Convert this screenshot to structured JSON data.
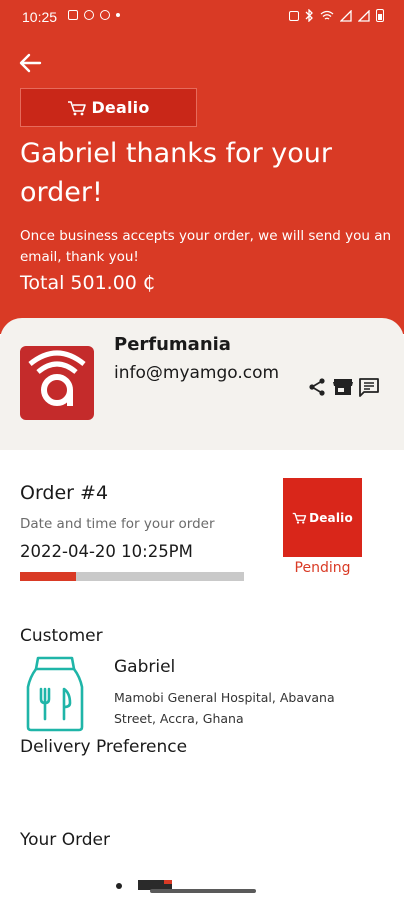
{
  "status_bar": {
    "time": "10:25",
    "left_icons": [
      "image-icon",
      "whatsapp-icon",
      "notification-icon",
      "dot-icon"
    ],
    "right_icons": [
      "alarm-icon",
      "bluetooth-icon",
      "wifi-icon",
      "signal-icon",
      "signal-icon",
      "battery-icon"
    ]
  },
  "header": {
    "back_icon": "arrow-left-icon",
    "brand": "Dealio",
    "title": "Gabriel thanks for your order!",
    "message": "Once business accepts your order, we will send you an email, thank you!",
    "total": "Total 501.00 ₵"
  },
  "business": {
    "name": "Perfumania",
    "email": "info@myamgo.com",
    "actions": [
      "share-icon",
      "store-icon",
      "message-icon"
    ]
  },
  "order": {
    "title": "Order #4",
    "date_label": "Date and time for your order",
    "datetime": "2022-04-20 10:25PM",
    "progress": 0.25,
    "status_brand": "Dealio",
    "status": "Pending"
  },
  "customer": {
    "heading": "Customer",
    "name": "Gabriel",
    "address": "Mamobi General Hospital, Abavana Street, Accra, Ghana",
    "icon": "food-bag-icon"
  },
  "sections": {
    "delivery_heading": "Delivery Preference",
    "your_order_heading": "Your Order"
  },
  "colors": {
    "brand_red": "#d93a25",
    "teal": "#1fb5a8"
  }
}
